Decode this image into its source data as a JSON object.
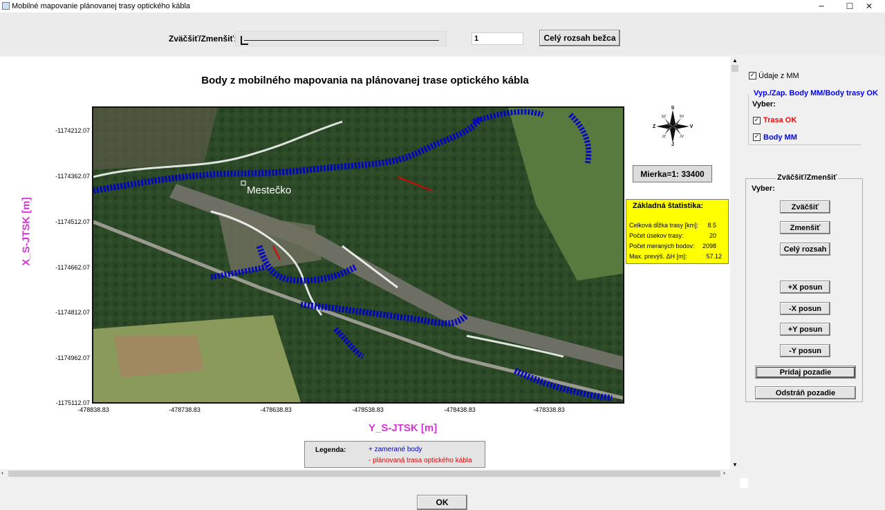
{
  "window": {
    "title": "Mobilné mapovanie plánovanej trasy optického kábla",
    "minimize": "─",
    "maximize": "☐",
    "close": "✕"
  },
  "toolbar": {
    "zoom_label": "Zväčšiť/Zmenšiť:",
    "zoom_value": "1",
    "full_extent_button": "Celý rozsah bežca"
  },
  "map": {
    "title": "Body z mobilného mapovania na plánovanej trase optického kábla",
    "place_label": "Mestečko",
    "y_axis_title": "X_S-JTSK [m]",
    "x_axis_title": "Y_S-JTSK [m]",
    "y_ticks": [
      "-1174212.07",
      "-1174362.07",
      "-1174512.07",
      "-1174662.07",
      "-1174812.07",
      "-1174962.07",
      "-1175112.07"
    ],
    "x_ticks": [
      "-478838.83",
      "-478738.83",
      "-478638.83",
      "-478538.83",
      "-478438.83",
      "-478338.83"
    ],
    "compass": {
      "n": "S",
      "s": "J",
      "w": "Z",
      "e": "V",
      "nw": "SZ",
      "ne": "SV",
      "sw": "JZ",
      "se": "JV"
    },
    "scale": "Mierka=1: 33400"
  },
  "stats": {
    "title": "Základná štatistika:",
    "rows": [
      {
        "label": "Celková dĺžka trasy [km]:",
        "value": "8.5"
      },
      {
        "label": "Počet úsekov trasy:",
        "value": "20"
      },
      {
        "label": "Počet meraných bodov:",
        "value": "2098"
      },
      {
        "label": "Max. prevýš. ΔH [m]:",
        "value": "57.12"
      }
    ]
  },
  "legend": {
    "title": "Legenda:",
    "points": "+ zamerané body",
    "route": "- plánovaná trasa optického kábla"
  },
  "side": {
    "mm_checkbox": "Údaje z MM",
    "mm_checked": true,
    "group_title": "Vyp./Zap. Body MM/Body trasy OK",
    "group_prompt": "Vyber:",
    "trasa_label": "Trasa OK",
    "trasa_checked": true,
    "body_label": "Body MM",
    "body_checked": true,
    "zoom_group_title": "Zväčšiť/Zmenšiť",
    "zoom_group_prompt": "Vyber:",
    "buttons": [
      "Zväčšiť",
      "Zmenšiť",
      "Celý rozsah",
      "+X posun",
      "-X posun",
      "+Y posun",
      "-Y posun",
      "Pridaj pozadie",
      "Odstráň pozadie"
    ]
  },
  "footer": {
    "ok": "OK"
  },
  "colors": {
    "points": "#0000c8",
    "route": "#e00000",
    "axis_title": "#d633d6",
    "stats_bg": "#ffff00"
  }
}
